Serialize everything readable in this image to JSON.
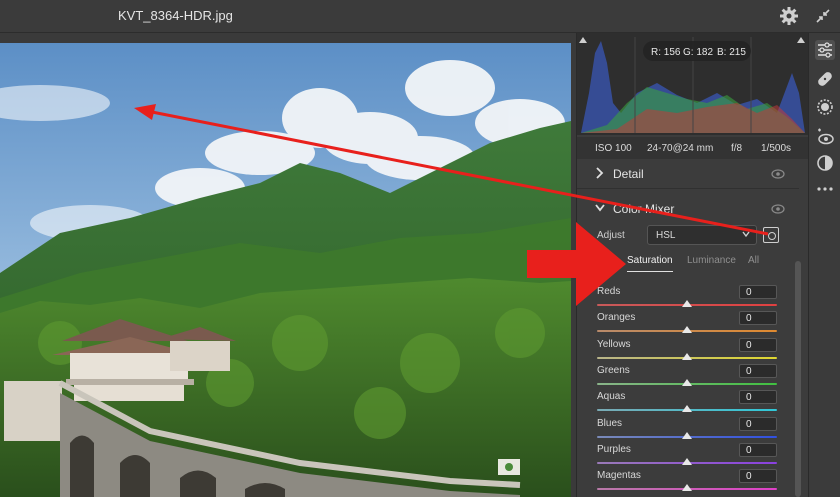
{
  "window": {
    "title": "KVT_8364-HDR.jpg"
  },
  "histogram": {
    "readout_r": "R: 156",
    "readout_g": "G: 182",
    "readout_b": "B: 215"
  },
  "exif": {
    "iso": "ISO 100",
    "lens": "24-70@24 mm",
    "aperture": "f/8",
    "shutter": "1/500s"
  },
  "sections": {
    "detail": "Detail",
    "color_mixer": "Color Mixer"
  },
  "adjust": {
    "label": "Adjust",
    "value": "HSL"
  },
  "tabs": [
    {
      "label": "Saturation",
      "active": true
    },
    {
      "label": "Luminance",
      "active": false
    },
    {
      "label": "All",
      "active": false
    }
  ],
  "sliders": [
    {
      "label": "Reds",
      "value": "0",
      "position": 0.5,
      "color_from": "#c85a5a",
      "color_to": "#e04040"
    },
    {
      "label": "Oranges",
      "value": "0",
      "position": 0.5,
      "color_from": "#b88a6a",
      "color_to": "#e08a30"
    },
    {
      "label": "Yellows",
      "value": "0",
      "position": 0.5,
      "color_from": "#b8b48a",
      "color_to": "#e0d830"
    },
    {
      "label": "Greens",
      "value": "0",
      "position": 0.5,
      "color_from": "#8ab48a",
      "color_to": "#40c040"
    },
    {
      "label": "Aquas",
      "value": "0",
      "position": 0.5,
      "color_from": "#7aaab4",
      "color_to": "#30c8d8"
    },
    {
      "label": "Blues",
      "value": "0",
      "position": 0.5,
      "color_from": "#7a8ab8",
      "color_to": "#3050e0"
    },
    {
      "label": "Purples",
      "value": "0",
      "position": 0.5,
      "color_from": "#9a7ab8",
      "color_to": "#8a40e0"
    },
    {
      "label": "Magentas",
      "value": "0",
      "position": 0.5,
      "color_from": "#b87aa8",
      "color_to": "#e040c8"
    }
  ],
  "tool_icons": [
    "edit-sliders-icon",
    "heal-icon",
    "mask-icon",
    "redeye-icon",
    "presets-icon",
    "more-icon"
  ],
  "colors": {
    "panel_bg": "#3c3c3c",
    "annotation_red": "#e8201c"
  }
}
